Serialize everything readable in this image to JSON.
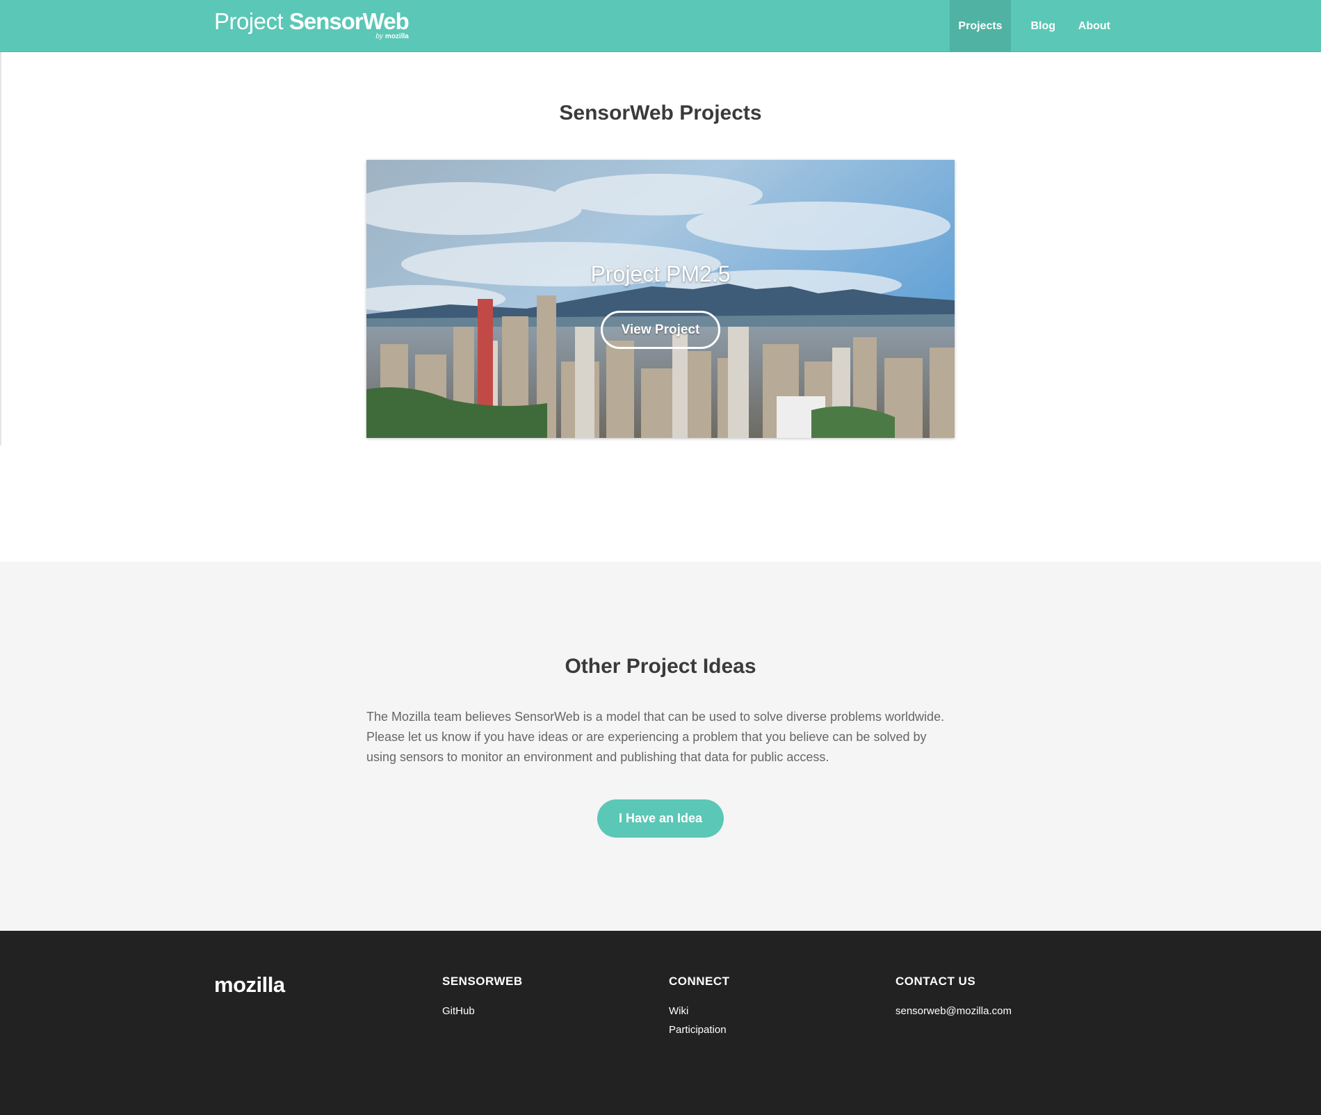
{
  "header": {
    "brand_prefix": "Project",
    "brand_name": "SensorWeb",
    "brand_sub_by": "by",
    "brand_sub_org": "mozilla",
    "nav": [
      {
        "label": "Projects",
        "active": true
      },
      {
        "label": "Blog",
        "active": false
      },
      {
        "label": "About",
        "active": false
      }
    ]
  },
  "projects": {
    "title": "SensorWeb Projects",
    "cards": [
      {
        "title": "Project PM2.5",
        "button_label": "View Project"
      }
    ]
  },
  "ideas": {
    "title": "Other Project Ideas",
    "text": "The Mozilla team believes SensorWeb is a model that can be used to solve diverse problems worldwide. Please let us know if you have ideas or are experiencing a problem that you believe can be solved by using sensors to monitor an environment and publishing that data for public access.",
    "button_label": "I Have an Idea"
  },
  "footer": {
    "logo": "mozilla",
    "columns": [
      {
        "heading": "SENSORWEB",
        "links": [
          "GitHub"
        ]
      },
      {
        "heading": "CONNECT",
        "links": [
          "Wiki",
          "Participation"
        ]
      },
      {
        "heading": "CONTACT US",
        "links": [
          "sensorweb@mozilla.com"
        ]
      }
    ]
  },
  "colors": {
    "accent": "#5bc7b6",
    "accent_active": "#4fb2a2",
    "footer_bg": "#222222",
    "ideas_bg": "#f5f5f5",
    "heading_text": "#3a3a3a",
    "body_text": "#666666"
  }
}
